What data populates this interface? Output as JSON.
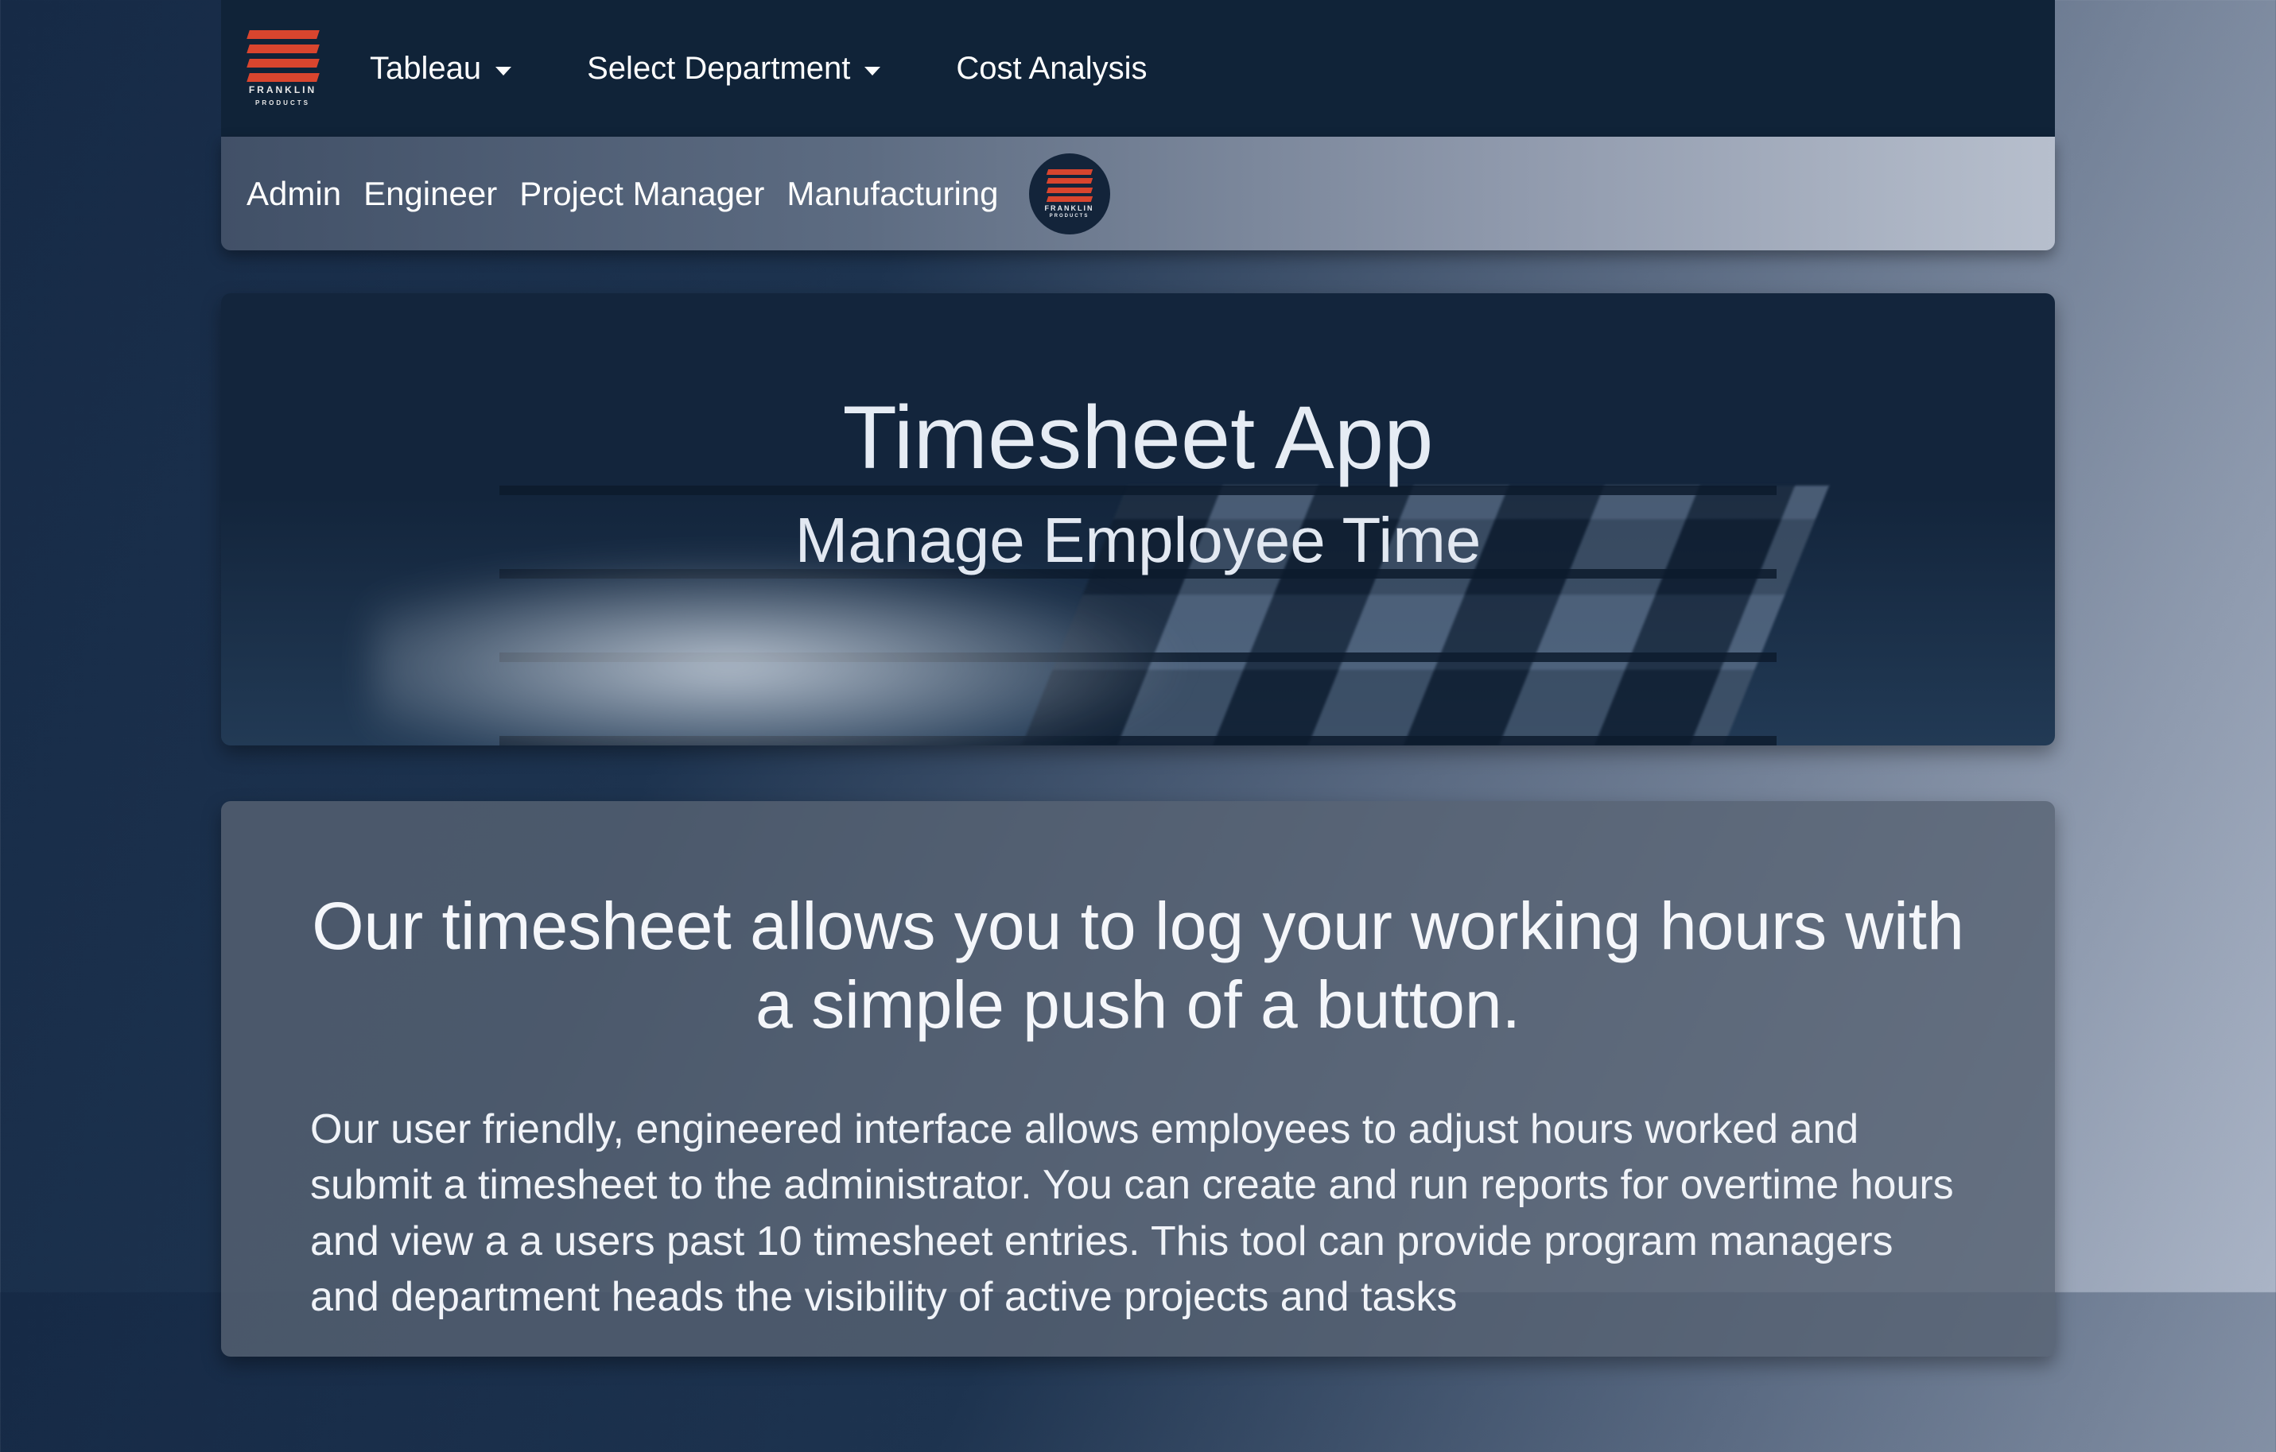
{
  "brand": {
    "name": "FRANKLIN",
    "sub": "PRODUCTS"
  },
  "topnav": {
    "items": [
      {
        "label": "Tableau",
        "has_caret": true
      },
      {
        "label": "Select Department",
        "has_caret": true
      },
      {
        "label": "Cost Analysis",
        "has_caret": false
      }
    ]
  },
  "subnav": {
    "items": [
      {
        "label": "Admin"
      },
      {
        "label": "Engineer"
      },
      {
        "label": "Project Manager"
      },
      {
        "label": "Manufacturing"
      }
    ]
  },
  "hero": {
    "title": "Timesheet App",
    "subtitle": "Manage Employee Time"
  },
  "content": {
    "heading": "Our timesheet allows you to log your working hours with a simple push of a button.",
    "body": "Our user friendly, engineered interface allows employees to adjust hours worked and submit a timesheet to the administrator. You can create and run reports for overtime hours and view a a users past 10 timesheet entries. This tool can provide program managers and department heads the visibility of active projects and tasks"
  }
}
